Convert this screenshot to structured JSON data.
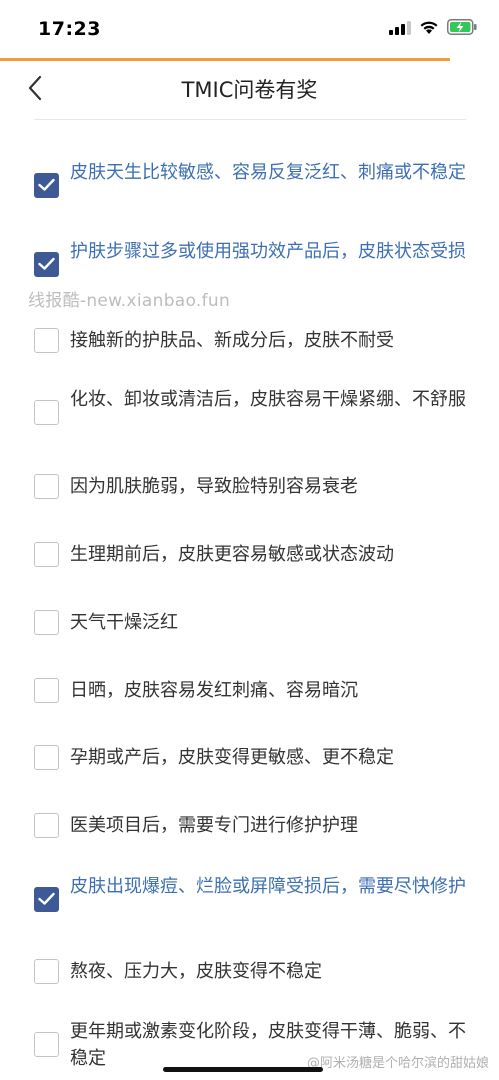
{
  "status_bar": {
    "time": "17:23"
  },
  "header": {
    "title": "TMIC问卷有奖"
  },
  "watermark": "线报酷-new.xianbao.fun",
  "weibo_watermark": "@阿米汤糖是个哈尔滨的甜姑娘",
  "options": [
    {
      "text": "皮肤天生比较敏感、容易反复泛红、刺痛或不稳定",
      "checked": true
    },
    {
      "text": "护肤步骤过多或使用强功效产品后，皮肤状态受损",
      "checked": true
    },
    {
      "text": "接触新的护肤品、新成分后，皮肤不耐受",
      "checked": false
    },
    {
      "text": "化妆、卸妆或清洁后，皮肤容易干燥紧绷、不舒服",
      "checked": false
    },
    {
      "text": "因为肌肤脆弱，导致脸特别容易衰老",
      "checked": false
    },
    {
      "text": "生理期前后，皮肤更容易敏感或状态波动",
      "checked": false
    },
    {
      "text": "天气干燥泛红",
      "checked": false
    },
    {
      "text": "日晒，皮肤容易发红刺痛、容易暗沉",
      "checked": false
    },
    {
      "text": "孕期或产后，皮肤变得更敏感、更不稳定",
      "checked": false
    },
    {
      "text": "医美项目后，需要专门进行修护护理",
      "checked": false
    },
    {
      "text": "皮肤出现爆痘、烂脸或屏障受损后，需要尽快修护",
      "checked": true
    },
    {
      "text": "熬夜、压力大，皮肤变得不稳定",
      "checked": false
    },
    {
      "text": "更年期或激素变化阶段，皮肤变得干薄、脆弱、不稳定",
      "checked": false
    }
  ],
  "colors": {
    "accent_line": "#f29b38",
    "checked_box": "#3d5a96",
    "checked_text": "#3d6fb3"
  }
}
